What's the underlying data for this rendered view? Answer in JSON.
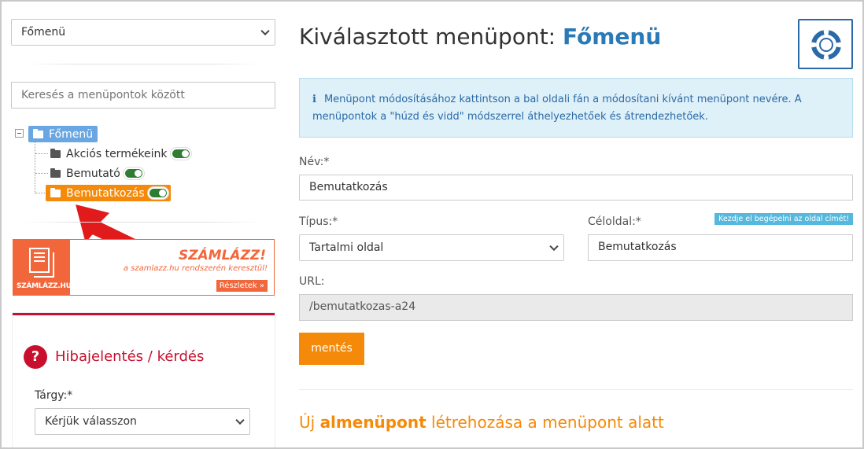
{
  "sidebar": {
    "menu_select": "Főmenü",
    "search_placeholder": "Keresés a menüpontok között",
    "tree": {
      "root": "Főmenü",
      "children": [
        {
          "label": "Akciós termékeink",
          "active": false,
          "enabled": true
        },
        {
          "label": "Bemutató",
          "active": false,
          "enabled": true
        },
        {
          "label": "Bemutatkozás",
          "active": true,
          "enabled": true
        }
      ]
    },
    "banner": {
      "brand": "SZÁMLÁZZ.HU",
      "title": "SZÁMLÁZZ!",
      "subtitle": "a szamlazz.hu rendszerén keresztül!",
      "button": "Részletek »"
    },
    "report": {
      "title": "Hibajelentés / kérdés",
      "subject_label": "Tárgy:*",
      "subject_select": "Kérjük válasszon"
    }
  },
  "main": {
    "title_prefix": "Kiválasztott menüpont:",
    "title_value": "Főmenü",
    "info_text": "Menüpont módosításához kattintson a bal oldali fán a módosítani kívánt menüpont nevére. A menüpontok a \"húzd és vidd\" módszerrel áthelyezhetőek és átrendezhetőek.",
    "name_label": "Név:*",
    "name_value": "Bemutatkozás",
    "type_label": "Típus:*",
    "type_value": "Tartalmi oldal",
    "target_label": "Céloldal:*",
    "target_value": "Bemutatkozás",
    "target_hint": "Kezdje el begépelni az oldal címét!",
    "url_label": "URL:",
    "url_value": "/bemutatkozas-a24",
    "save_label": "mentés",
    "sub_pre": "Új",
    "sub_bold": "almenüpont",
    "sub_post": "létrehozása a menüpont alatt"
  },
  "colors": {
    "accent_orange": "#f58a0a",
    "accent_blue": "#2a7ab8",
    "info_bg": "#def0f8",
    "report_red": "#c8102e",
    "toggle_green": "#2f7d32"
  },
  "icons": [
    "chevron-down-icon",
    "folder-icon",
    "lifebuoy-icon",
    "info-icon",
    "question-icon",
    "red-arrow-icon"
  ]
}
